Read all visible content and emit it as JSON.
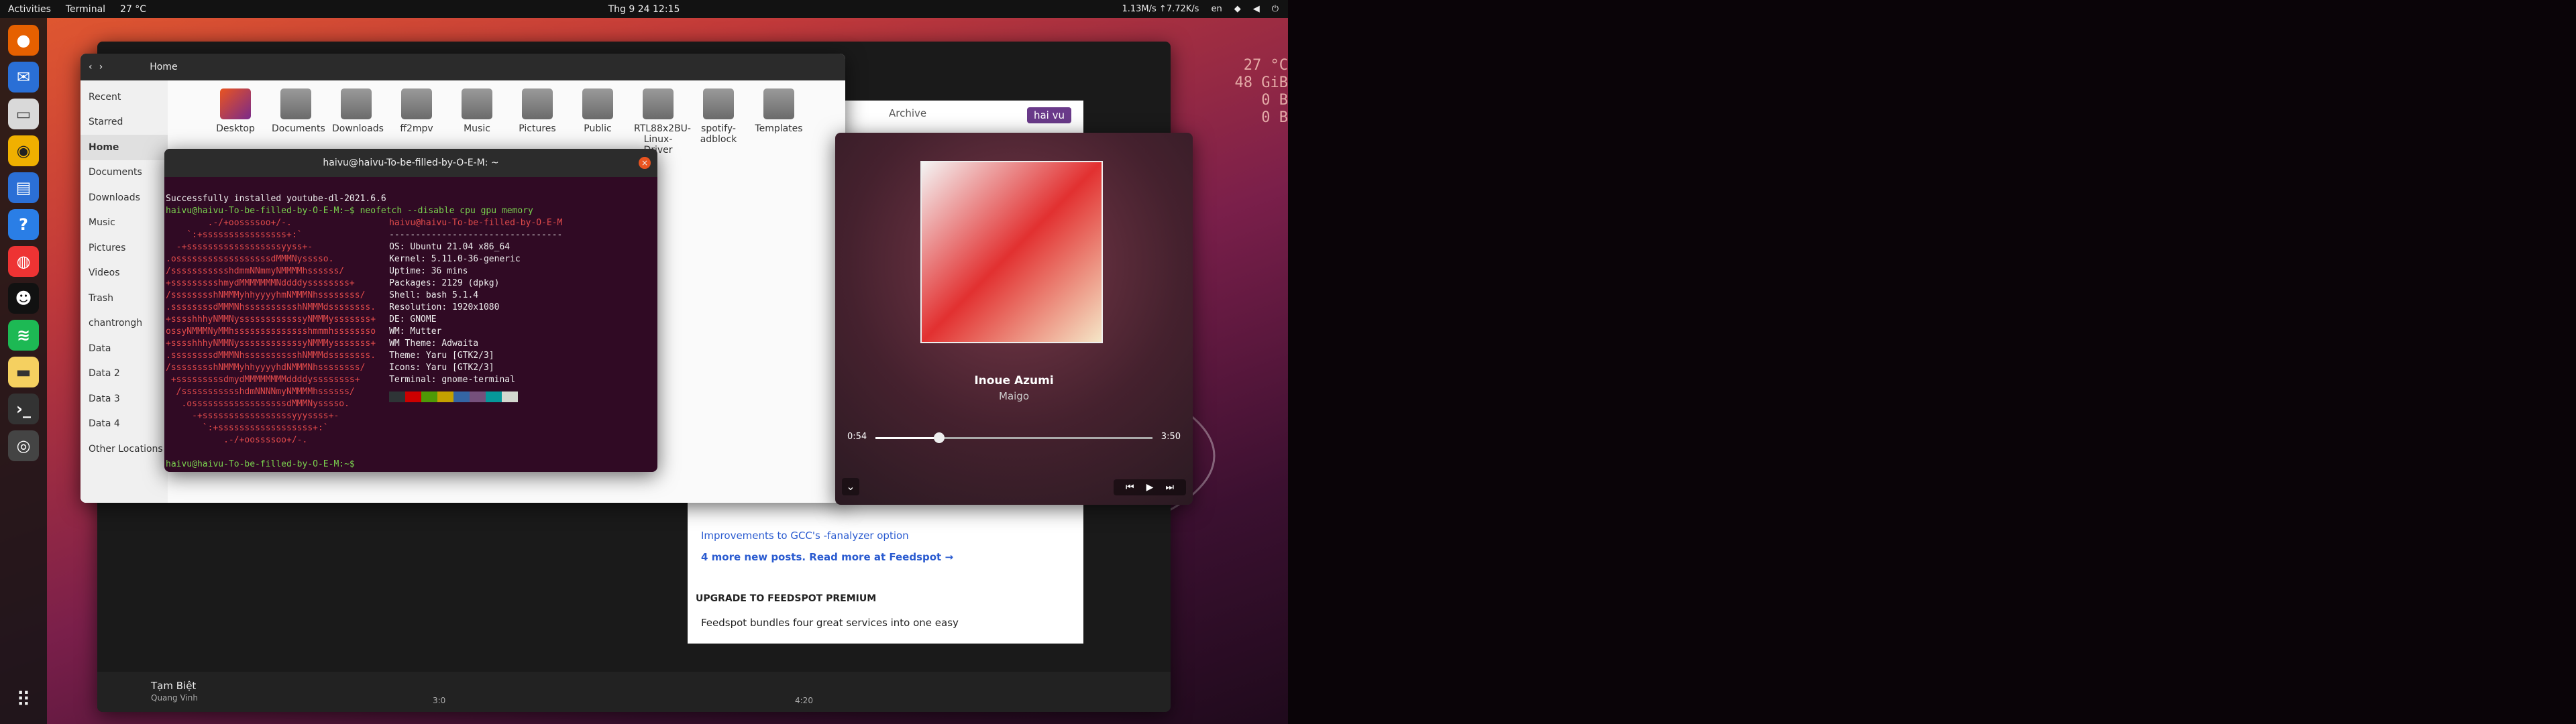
{
  "topbar": {
    "activities": "Activities",
    "app": "Terminal",
    "weather": "27 °C",
    "clock": "Thg 9 24  12:15",
    "net": "1.13M/s ↑7.72K/s",
    "lang": "en"
  },
  "files": {
    "title": "Home",
    "sidebar": [
      "Recent",
      "Starred",
      "Home",
      "Documents",
      "Downloads",
      "Music",
      "Pictures",
      "Videos",
      "Trash",
      "chantrongh",
      "Data",
      "Data 2",
      "Data 3",
      "Data 4",
      "Other Locations"
    ],
    "folders": [
      "Desktop",
      "Documents",
      "Downloads",
      "ff2mpv",
      "Music",
      "Pictures",
      "Public",
      "RTL88x2BU-Linux-Driver",
      "spotify-adblock",
      "Templates"
    ]
  },
  "terminal": {
    "title": "haivu@haivu-To-be-filled-by-O-E-M: ~",
    "lines": [
      "Successfully installed youtube-dl-2021.6.6",
      "haivu@haivu-To-be-filled-by-O-E-M:~$ neofetch --disable cpu gpu memory"
    ],
    "info": [
      "haivu@haivu-To-be-filled-by-O-E-M",
      "OS: Ubuntu 21.04 x86_64",
      "Kernel: 5.11.0-36-generic",
      "Uptime: 36 mins",
      "Packages: 2129 (dpkg)",
      "Shell: bash 5.1.4",
      "Resolution: 1920x1080",
      "DE: GNOME",
      "WM: Mutter",
      "WM Theme: Adwaita",
      "Theme: Yaru [GTK2/3]",
      "Icons: Yaru [GTK2/3]",
      "Terminal: gnome-terminal"
    ],
    "prompt": "haivu@haivu-To-be-filled-by-O-E-M:~$"
  },
  "player": {
    "title": "Inoue Azumi",
    "artist": "Maigo",
    "elapsed": "0:54",
    "total": "3:50",
    "progress": 0.23
  },
  "bg_music": {
    "track": "Tạm Biệt",
    "artist": "Quang Vinh",
    "elapsed": "3:0",
    "total": "4:20"
  },
  "feed": {
    "items": [
      "Improvements to GCC's -fanalyzer option",
      "4 more new posts. Read more at Feedspot →",
      "UPGRADE TO FEEDSPOT PREMIUM",
      "Feedspot bundles four great services into one easy"
    ],
    "archive": "Archive",
    "user": "hai vu"
  },
  "conky": [
    "27 °C",
    "48 GiB",
    "0 B",
    "0 B"
  ]
}
